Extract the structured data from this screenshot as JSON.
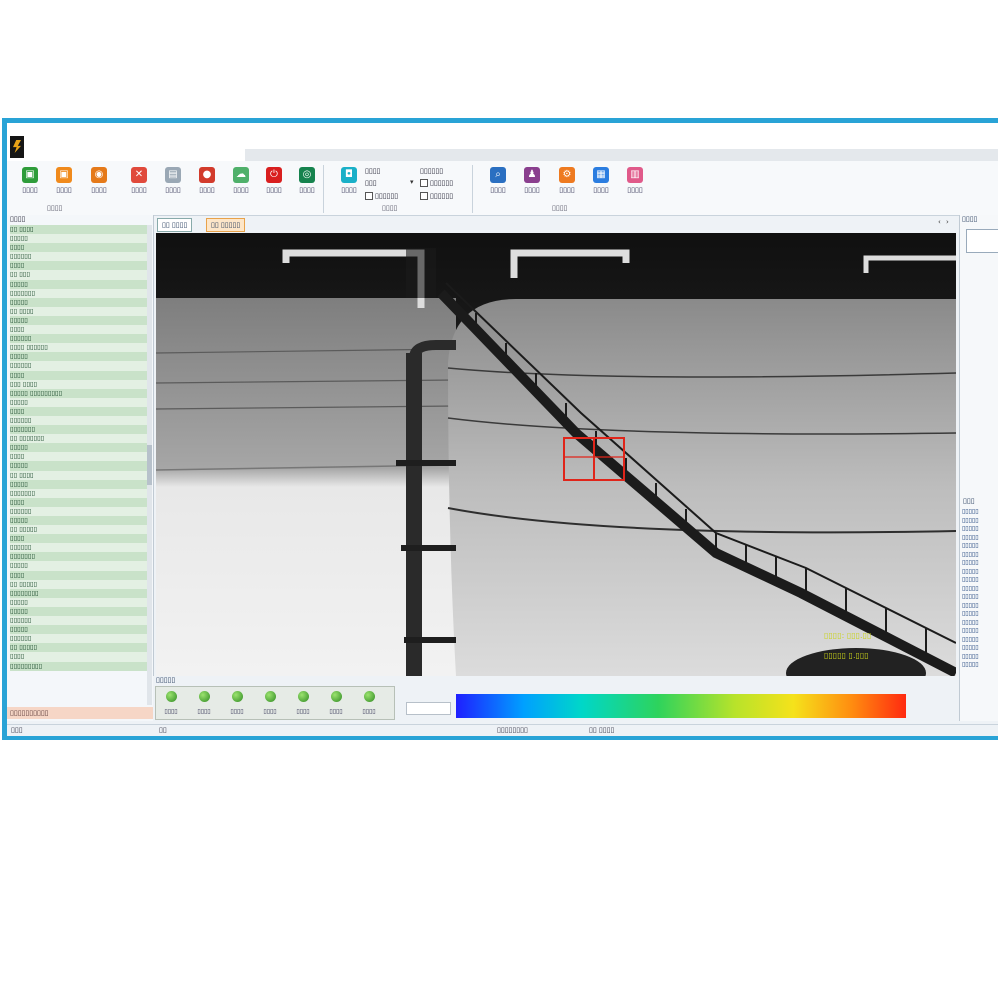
{
  "window": {
    "border_color": "#29a3d6",
    "logo_icon": "bolt-logo-icon"
  },
  "ribbon": {
    "buttons": [
      {
        "label": "▯▯▯▯",
        "icon": "green-square-icon",
        "color": "#2e9c3a",
        "glyph": "▣"
      },
      {
        "label": "▯▯▯▯",
        "icon": "orange-square-icon",
        "color": "#f08a1c",
        "glyph": "▣"
      },
      {
        "label": "▯▯▯▯",
        "icon": "orange-circle-icon",
        "color": "#e57a1a",
        "glyph": "◉"
      },
      {
        "label": "▯▯▯▯",
        "icon": "close-x-icon",
        "color": "#e04a3c",
        "glyph": "✕"
      },
      {
        "label": "▯▯▯▯",
        "icon": "gray-document-icon",
        "color": "#9aa8b5",
        "glyph": "▤"
      },
      {
        "label": "▯▯▯▯",
        "icon": "red-shape-icon",
        "color": "#d23b2c",
        "glyph": "●"
      },
      {
        "label": "▯▯▯▯",
        "icon": "green-cloud-icon",
        "color": "#4fb06a",
        "glyph": "☁"
      },
      {
        "label": "▯▯▯▯",
        "icon": "power-icon",
        "color": "#d91f1f",
        "glyph": "⏻"
      },
      {
        "label": "▯▯▯▯",
        "icon": "green-shield-icon",
        "color": "#16834e",
        "glyph": "◎"
      },
      {
        "label": "▯▯▯▯",
        "icon": "chat-icon",
        "color": "#1ab0c8",
        "glyph": "◘"
      },
      {
        "label": "▯▯▯▯",
        "icon": "blue-search-icon",
        "color": "#2a6fc1",
        "glyph": "⌕"
      },
      {
        "label": "▯▯▯▯",
        "icon": "user-icon",
        "color": "#8a3f8e",
        "glyph": "♟"
      },
      {
        "label": "▯▯▯▯",
        "icon": "orange-gear-icon",
        "color": "#ee7a20",
        "glyph": "⚙"
      },
      {
        "label": "▯▯▯▯",
        "icon": "blue-app-icon",
        "color": "#2b7de0",
        "glyph": "▦"
      },
      {
        "label": "▯▯▯▯",
        "icon": "pink-grid-icon",
        "color": "#e05a8a",
        "glyph": "▥"
      }
    ],
    "options": [
      "▯▯▯▯",
      "▯▯▯",
      "▯▯▯▯▯▯",
      "▯▯▯▯▯▯",
      "▯▯▯▯▯▯",
      "▯▯▯▯▯▯"
    ],
    "groups": [
      "▯▯▯▯",
      "▯▯▯▯",
      "▯▯▯▯"
    ]
  },
  "left_panel": {
    "header": "▯▯▯▯",
    "items": [
      "▯▯ ▯▯▯▯",
      "▯▯▯▯▯",
      "▯▯▯▯",
      "▯▯▯▯▯▯",
      "▯▯▯▯",
      "▯▯ ▯▯▯",
      "▯▯▯▯▯",
      "▯▯▯▯▯▯▯",
      "▯▯▯▯▯",
      "▯▯ ▯▯▯▯",
      "▯▯▯▯▯",
      "▯▯▯▯",
      "▯▯▯▯▯▯",
      "▯▯▯▯ ▯▯▯▯▯▯",
      "▯▯▯▯▯",
      "▯▯▯▯▯▯",
      "▯▯▯▯",
      "▯▯▯ ▯▯▯▯",
      "▯▯▯▯▯ ▯▯▯▯▯▯▯▯▯",
      "▯▯▯▯▯",
      "▯▯▯▯",
      "▯▯▯▯▯▯",
      "▯▯▯▯▯▯▯",
      "▯▯ ▯▯▯▯▯▯▯",
      "▯▯▯▯▯",
      "▯▯▯▯",
      "▯▯▯▯▯",
      "▯▯ ▯▯▯▯",
      "▯▯▯▯▯",
      "▯▯▯▯▯▯▯",
      "▯▯▯▯",
      "▯▯▯▯▯▯",
      "▯▯▯▯▯",
      "▯▯ ▯▯▯▯▯",
      "▯▯▯▯",
      "▯▯▯▯▯▯",
      "▯▯▯▯▯▯▯",
      "▯▯▯▯▯",
      "▯▯▯▯",
      "▯▯ ▯▯▯▯▯",
      "▯▯▯▯▯▯▯▯",
      "▯▯▯▯▯",
      "▯▯▯▯▯",
      "▯▯▯▯▯▯",
      "▯▯▯▯▯",
      "▯▯▯▯▯▯",
      "▯▯ ▯▯▯▯▯",
      "▯▯▯▯",
      "▯▯▯▯▯▯▯▯▯"
    ],
    "footer": "▯▯▯▯▯▯▯▯▯▯"
  },
  "tabs": [
    {
      "label": "▯▯ ▯▯▯▯"
    },
    {
      "label": "▯▯ ▯▯▯▯▯"
    }
  ],
  "tab_controls": [
    "‹",
    "›",
    "×"
  ],
  "video": {
    "osd_line1": "▯▯▯▯: ▯▯▯.▯▯",
    "osd_line2": "▯▯▯▯▯  ▯.▯▯▯",
    "osd_color": "#c9d41a",
    "target_box_color": "#e0251a"
  },
  "bottom": {
    "status_header": "▯▯▯▯▯",
    "indicators": [
      "▯▯▯▯",
      "▯▯▯▯",
      "▯▯▯▯",
      "▯▯▯▯",
      "▯▯▯▯",
      "▯▯▯▯",
      "▯▯▯▯"
    ],
    "indicator_color": "#3fa52c",
    "color_scale_stops": [
      "#1f1fff",
      "#00a0ff",
      "#00d7c8",
      "#2ed35c",
      "#b8e32a",
      "#f5e21b",
      "#ff8c10",
      "#ff2a10"
    ]
  },
  "right_panel": {
    "header": "▯▯▯▯",
    "list_header": "▯▯▯",
    "items": [
      "▯▯▯▯▯",
      "▯▯▯▯▯",
      "▯▯▯▯▯",
      "▯▯▯▯▯",
      "▯▯▯▯▯",
      "▯▯▯▯▯",
      "▯▯▯▯▯",
      "▯▯▯▯▯",
      "▯▯▯▯▯",
      "▯▯▯▯▯",
      "▯▯▯▯▯",
      "▯▯▯▯▯",
      "▯▯▯▯▯",
      "▯▯▯▯▯",
      "▯▯▯▯▯",
      "▯▯▯▯▯",
      "▯▯▯▯▯",
      "▯▯▯▯▯",
      "▯▯▯▯▯"
    ]
  },
  "statusbar": {
    "left": "▯▯▯",
    "mid": "▯▯",
    "center": "▯▯▯▯▯▯▯▯",
    "right": "▯▯ ▯▯▯▯"
  }
}
